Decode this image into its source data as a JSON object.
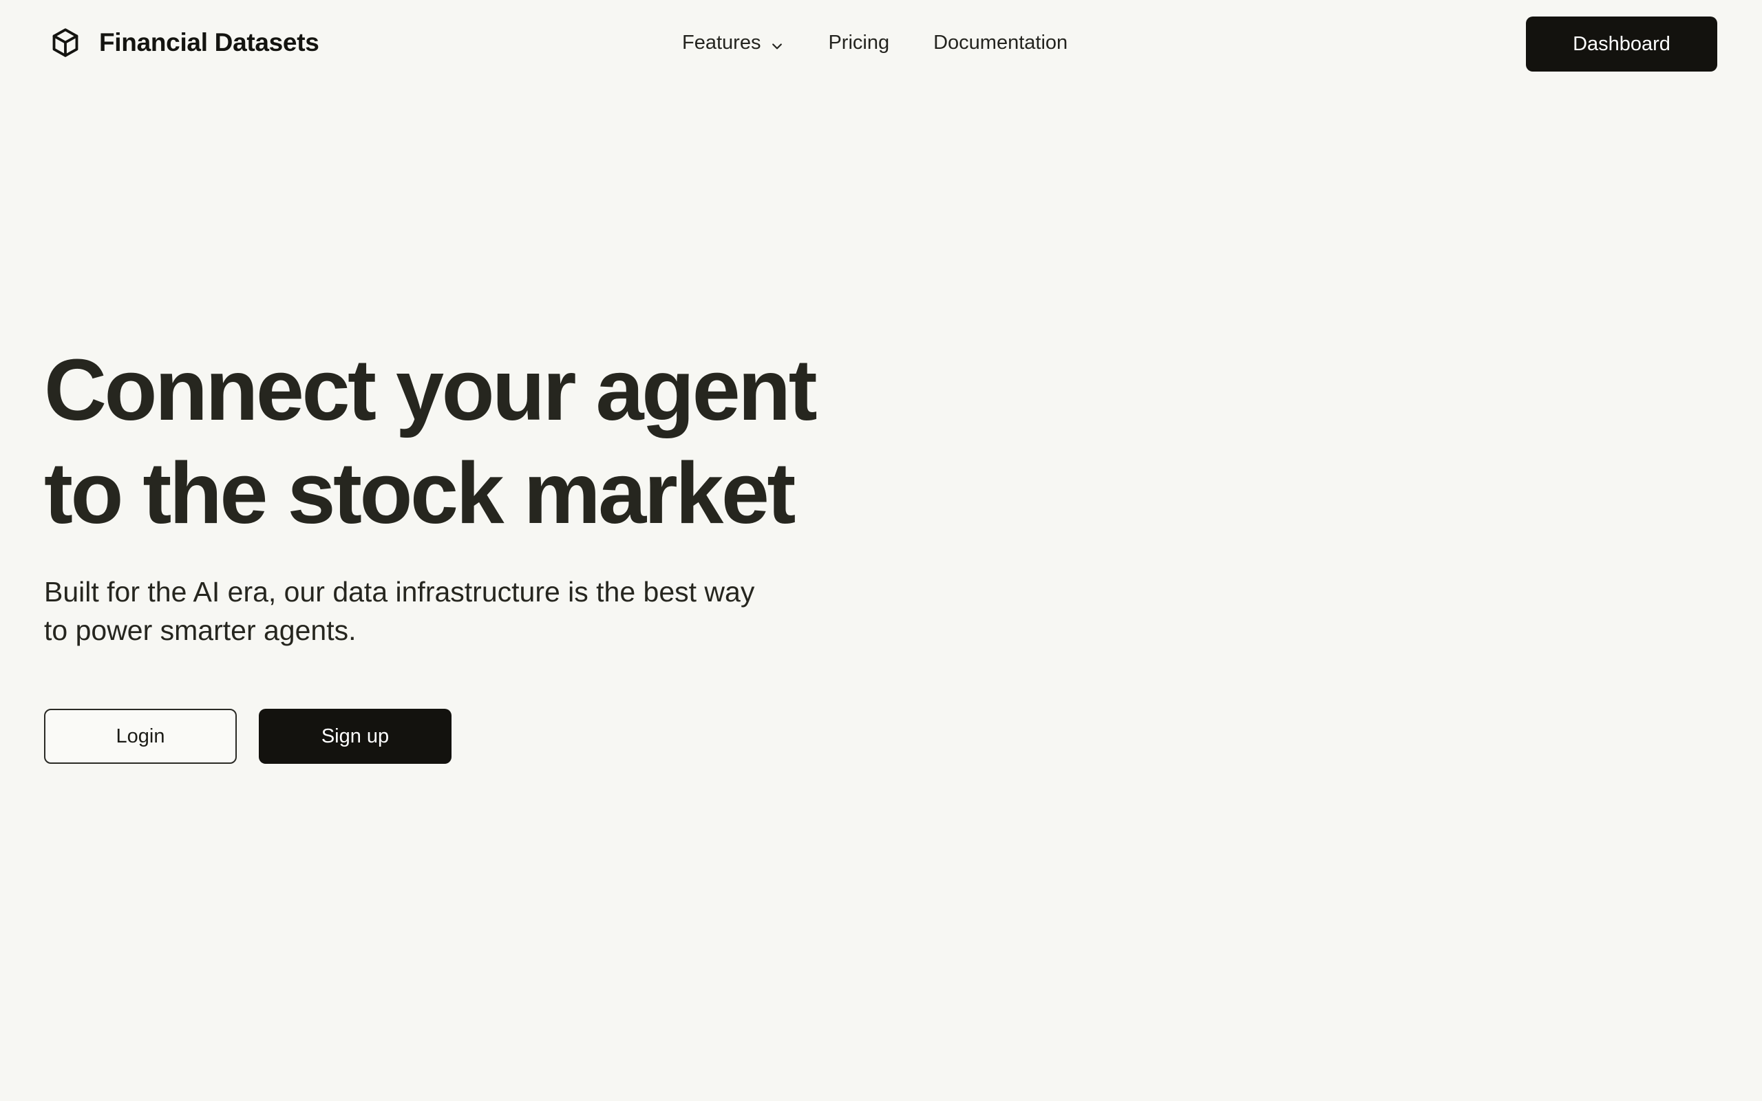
{
  "brand": {
    "name": "Financial Datasets",
    "icon": "cube-icon"
  },
  "nav": {
    "features_label": "Features",
    "features_icon": "chevron-down-icon",
    "pricing_label": "Pricing",
    "documentation_label": "Documentation"
  },
  "header": {
    "dashboard_label": "Dashboard"
  },
  "hero": {
    "title_line1": "Connect your agent",
    "title_line2": "to the stock market",
    "subtitle_line1": "Built for the AI era, our data infrastructure is the best way",
    "subtitle_line2": "to power smarter agents.",
    "login_label": "Login",
    "signup_label": "Sign up"
  },
  "colors": {
    "background": "#f7f7f3",
    "primary": "#13120e",
    "text": "#26261f"
  }
}
